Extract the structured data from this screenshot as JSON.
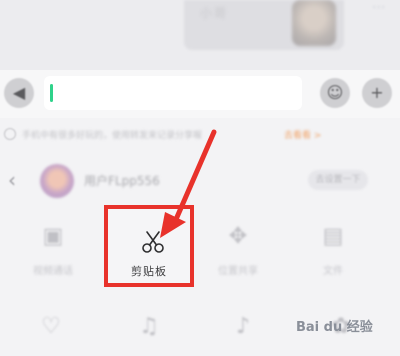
{
  "top": {
    "bubble_text": "小哥",
    "more_glyph": "···"
  },
  "input_bar": {
    "left_icon": "◀",
    "input_value": "",
    "emoji_icon": "☺",
    "plus_icon": "+"
  },
  "notice": {
    "text": "手机中有很多好玩的，使用转发来记录分享喔",
    "link": "去看看 >"
  },
  "account": {
    "back_icon": "‹",
    "name": "用户FLpp556",
    "tag": "去设置一下"
  },
  "tiles_row1": [
    {
      "icon": "▣",
      "label": "视频通话"
    },
    {
      "icon": "✥",
      "label": "位置共享"
    },
    {
      "icon": "▤",
      "label": "文件"
    }
  ],
  "tiles_row2": [
    {
      "icon": "♡"
    },
    {
      "icon": "♫"
    },
    {
      "icon": "♪"
    },
    {
      "icon": "✿"
    }
  ],
  "clipboard": {
    "label": "剪贴板",
    "icon": "scissors-icon",
    "accent": "#e8322b"
  },
  "watermark": {
    "text": "Bai du 经验"
  }
}
